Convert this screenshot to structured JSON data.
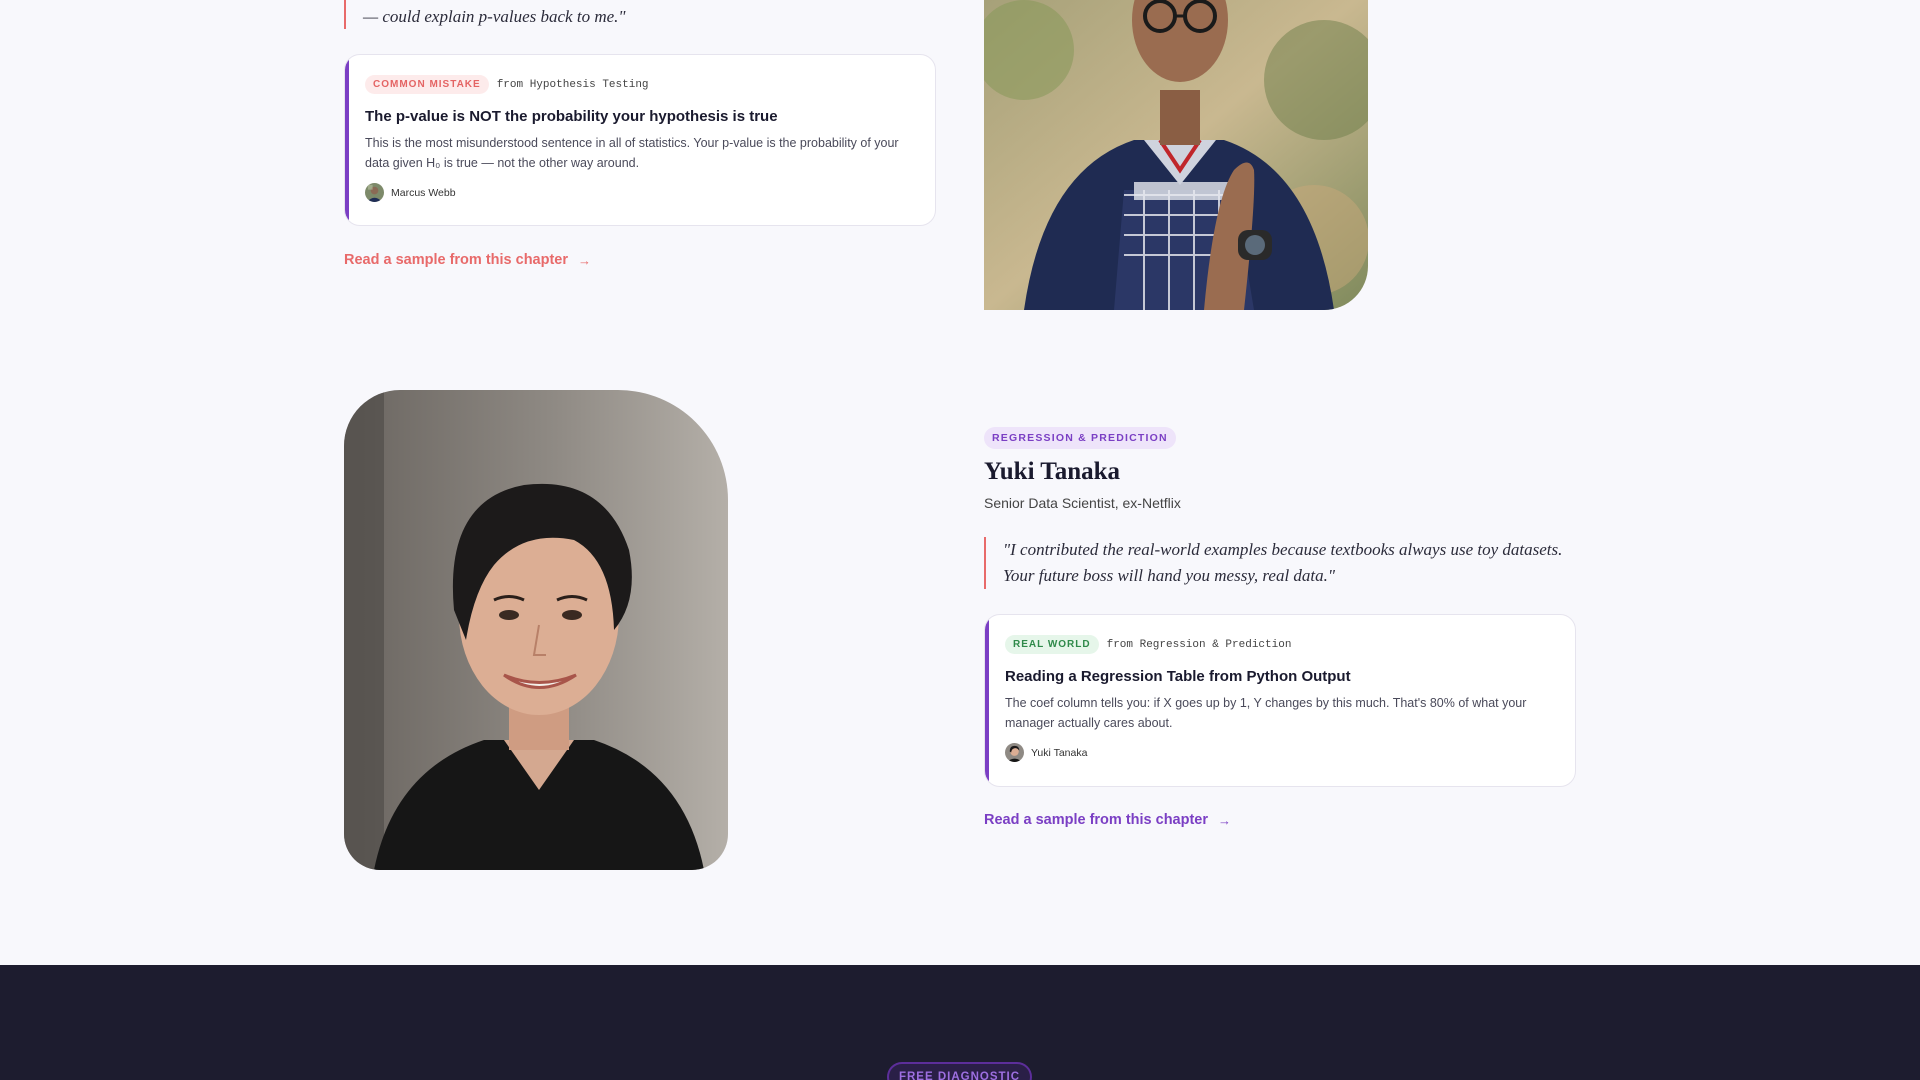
{
  "top_section": {
    "quote_fragment": "— could explain p-values back to me.\"",
    "card": {
      "chip": "Common Mistake",
      "from": "from Hypothesis Testing",
      "title": "The p-value is NOT the probability your hypothesis is true",
      "body": "This is the most misunderstood sentence in all of statistics. Your p-value is the probability of your data given H₀ is true — not the other way around.",
      "author": "Marcus Webb"
    },
    "read_link": "Read a sample from this chapter",
    "arrow": "→"
  },
  "yuki_section": {
    "tag": "Regression & Prediction",
    "name": "Yuki Tanaka",
    "role": "Senior Data Scientist, ex-Netflix",
    "quote": "\"I contributed the real-world examples because textbooks always use toy datasets. Your future boss will hand you messy, real data.\"",
    "card": {
      "chip": "Real World",
      "from": "from Regression & Prediction",
      "title": "Reading a Regression Table from Python Output",
      "body": "The coef column tells you: if X goes up by 1, Y changes by this much. That's 80% of what your manager actually cares about.",
      "author": "Yuki Tanaka"
    },
    "read_link": "Read a sample from this chapter",
    "arrow": "→"
  },
  "footer_band": {
    "pill": "FREE DIAGNOSTIC"
  },
  "colors": {
    "accent_purple": "#7b3fc4",
    "accent_coral": "#e86a6a",
    "dark_band": "#1d1c2f",
    "background": "#f8f8fc"
  }
}
